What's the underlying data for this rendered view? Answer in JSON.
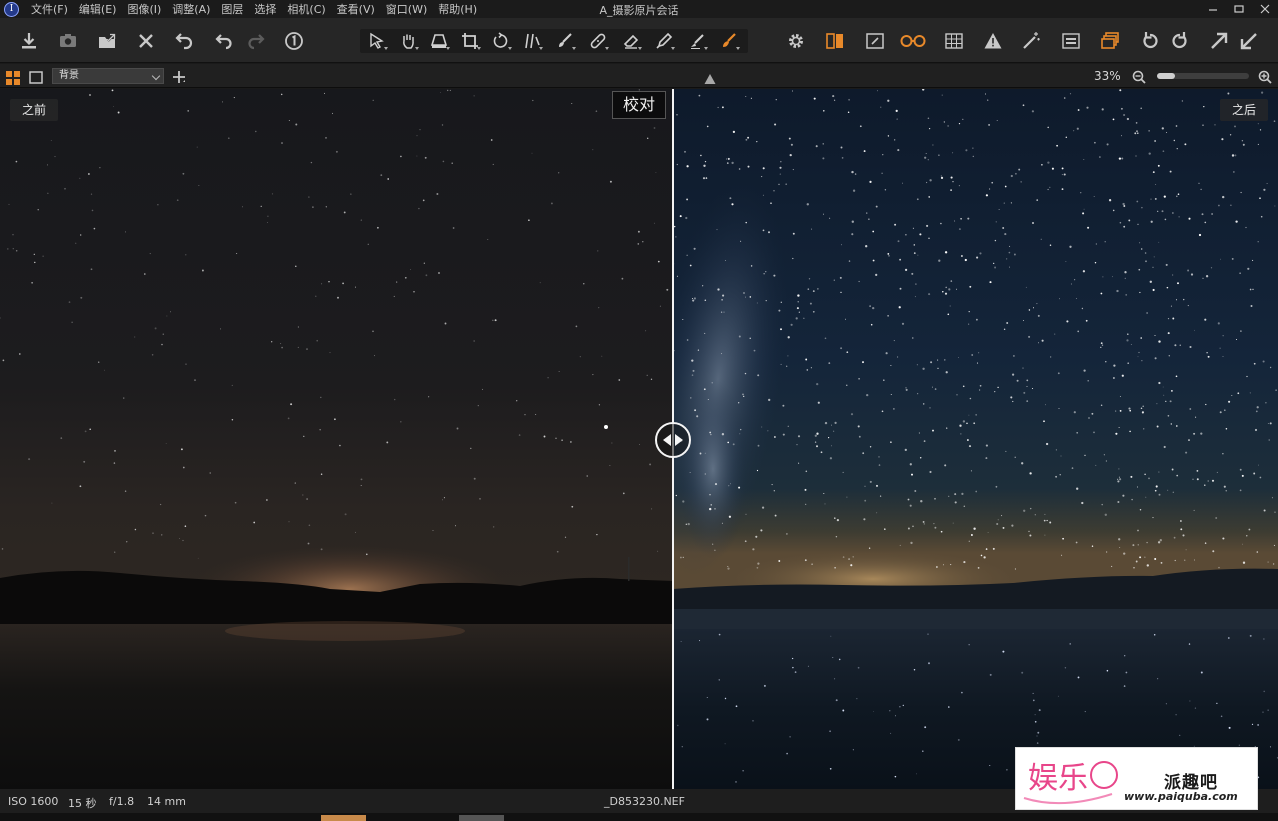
{
  "window": {
    "title": "A_摄影原片会话",
    "logo_glyph": "I"
  },
  "menu": [
    "文件(F)",
    "编辑(E)",
    "图像(I)",
    "调整(A)",
    "图层",
    "选择",
    "相机(C)",
    "查看(V)",
    "窗口(W)",
    "帮助(H)"
  ],
  "toolbar": {
    "left_icons": [
      "import-icon",
      "camera-capture-icon",
      "export-icon",
      "delete-icon",
      "undo-history-icon",
      "undo-icon",
      "redo-icon",
      "info-icon"
    ],
    "tools": [
      "select-arrow-icon",
      "pan-hand-icon",
      "keystone-icon",
      "crop-icon",
      "rotate-icon",
      "straighten-icon",
      "brush-icon",
      "healing-icon",
      "eraser-icon",
      "eyedropper-icon",
      "gradient-icon",
      "active-brush-icon"
    ],
    "right_icons": [
      "settings-gear-icon",
      "before-after-icon",
      "edit-mask-icon",
      "loupe-glasses-icon",
      "grid-icon",
      "exposure-warning-icon",
      "magic-wand-icon",
      "overlay-icon",
      "variants-icon",
      "rotate-left-icon",
      "rotate-right-icon",
      "expand-icon",
      "collapse-icon"
    ],
    "accent_color": "#e8892a"
  },
  "viewbar": {
    "layer_select": "背景",
    "zoom_value": "33%",
    "zoom_fraction": 0.2
  },
  "viewer": {
    "before_label": "之前",
    "after_label": "之后",
    "proof_label": "校对"
  },
  "status": {
    "iso": "ISO 1600",
    "shutter": "15 秒",
    "aperture": "f/1.8",
    "focal": "14 mm",
    "filename": "_D853230.NEF"
  },
  "watermark": {
    "logo_text": "娱乐",
    "site_name": "派趣吧",
    "url": "www.paiquba.com"
  }
}
